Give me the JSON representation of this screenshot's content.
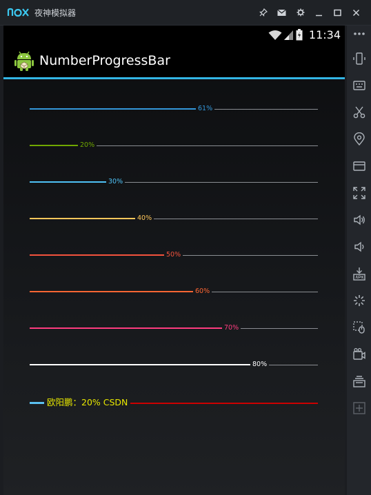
{
  "window": {
    "title": "夜神模拟器",
    "logo_text": "nox",
    "controls": [
      "pin-icon",
      "envelope-icon",
      "gear-icon",
      "minimize-icon",
      "maximize-icon",
      "close-icon"
    ]
  },
  "statusbar": {
    "time": "11:34",
    "icons": [
      "wifi-icon",
      "signal-icon",
      "battery-icon"
    ]
  },
  "actionbar": {
    "title": "NumberProgressBar",
    "icon": "android-icon"
  },
  "progress_bars": [
    {
      "text": "61%",
      "progress": 61,
      "reached_color": "#3498db",
      "text_color": "#3498db",
      "unreached_color": "#8b8e93"
    },
    {
      "text": "20%",
      "progress": 20,
      "reached_color": "#70a800",
      "text_color": "#70a800",
      "unreached_color": "#8b8e93"
    },
    {
      "text": "30%",
      "progress": 30,
      "reached_color": "#4fc3f7",
      "text_color": "#4fc3f7",
      "unreached_color": "#8b8e93"
    },
    {
      "text": "40%",
      "progress": 40,
      "reached_color": "#ffc75b",
      "text_color": "#ffc75b",
      "unreached_color": "#8b8e93"
    },
    {
      "text": "50%",
      "progress": 50,
      "reached_color": "#f4533d",
      "text_color": "#f4533d",
      "unreached_color": "#8b8e93"
    },
    {
      "text": "60%",
      "progress": 60,
      "reached_color": "#ff6633",
      "text_color": "#ff6633",
      "unreached_color": "#8b8e93"
    },
    {
      "text": "70%",
      "progress": 70,
      "reached_color": "#ff3d7f",
      "text_color": "#ff3d7f",
      "unreached_color": "#8b8e93"
    },
    {
      "text": "80%",
      "progress": 80,
      "reached_color": "#ffffff",
      "text_color": "#ffffff",
      "unreached_color": "#8b8e93"
    }
  ],
  "custom_bar": {
    "text": "欧阳鹏：20%  CSDN",
    "progress": 20,
    "reached_color": "#5bc0f0",
    "text_color": "#e8e800",
    "unreached_color": "#cc0000"
  },
  "toolbar": {
    "items": [
      "more-icon",
      "phone-rotate-icon",
      "keyboard-icon",
      "scissors-icon",
      "location-icon",
      "screen-icon",
      "fullscreen-icon",
      "volume-up-icon",
      "volume-down-icon",
      "apk-install-icon",
      "loading-icon",
      "macro-icon",
      "video-record-icon",
      "multi-instance-icon",
      "add-icon"
    ]
  }
}
